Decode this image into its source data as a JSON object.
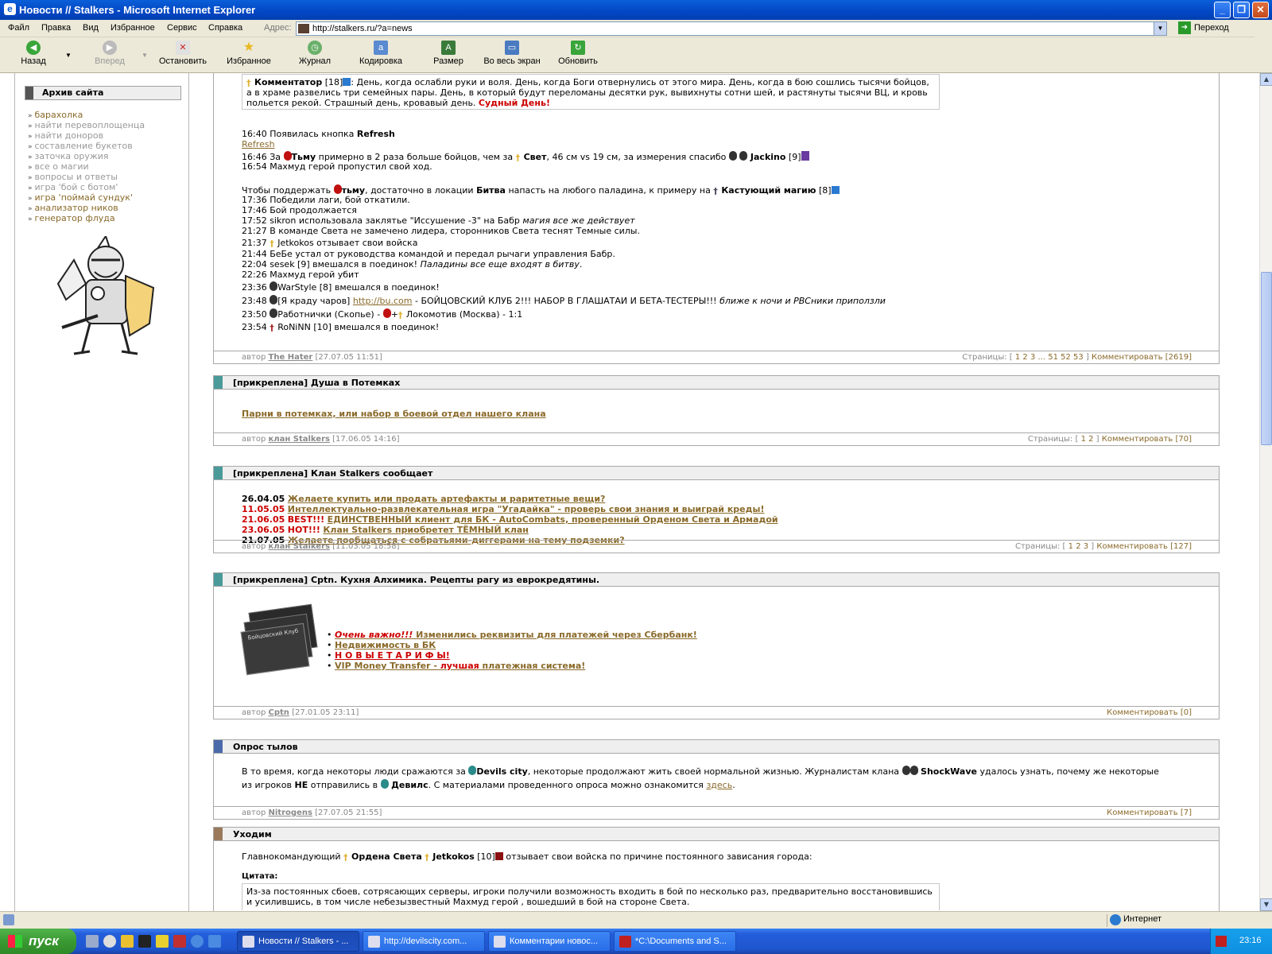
{
  "window": {
    "title": "Новости // Stalkers - Microsoft Internet Explorer"
  },
  "menu": [
    "Файл",
    "Правка",
    "Вид",
    "Избранное",
    "Сервис",
    "Справка"
  ],
  "address": {
    "label": "Адрес:",
    "url": "http://stalkers.ru/?a=news",
    "go": "Переход"
  },
  "toolbar": {
    "back": "Назад",
    "forward": "Вперед",
    "stop": "Остановить",
    "favorites": "Избранное",
    "history": "Журнал",
    "encoding": "Кодировка",
    "size": "Размер",
    "fullscreen": "Во весь экран",
    "refresh": "Обновить"
  },
  "sidebar": {
    "archive_title": "Архив сайта",
    "items": [
      {
        "label": "барахолка",
        "style": "brown"
      },
      {
        "label": "найти перевоплощенца",
        "style": "gray"
      },
      {
        "label": "найти доноров",
        "style": "gray"
      },
      {
        "label": "составление букетов",
        "style": "gray"
      },
      {
        "label": "заточка оружия",
        "style": "gray"
      },
      {
        "label": "все о магии",
        "style": "gray"
      },
      {
        "label": "вопросы и ответы",
        "style": "gray"
      },
      {
        "label": "игра 'бой с ботом'",
        "style": "gray"
      },
      {
        "label": "игра 'поймай сундук'",
        "style": "brown"
      },
      {
        "label": "анализатор ников",
        "style": "brown"
      },
      {
        "label": "генератор флуда",
        "style": "brown"
      }
    ]
  },
  "post1": {
    "quote_name": "Комментатор",
    "quote_level": "[18]",
    "quote_text_a": ": День, когда ослабли руки и воля. День, когда Боги отвернулись от этого мира. День, когда в бою сошлись тысячи бойцов,",
    "quote_text_b": "а в храме развелись три семейных пары. День, в который будут переломаны десятки рук, вывихнуты сотни шей, и растянуты тысячи ВЦ, и кровь",
    "quote_text_c": "польется рекой. Страшный день, кровавый день.",
    "quote_red": "Судный День!",
    "l1_time": "16:40 Появилась кнопка",
    "l1_bold": "Refresh",
    "l1_link": "Refresh",
    "l2_a": "16:46 За",
    "l2_b": "Тьму",
    "l2_c": "примерно в 2 раза больше бойцов, чем за",
    "l2_d": "Свет",
    "l2_e": ", 46 см vs 19 см, за измерения спасибо",
    "l2_f": "Jackino",
    "l2_g": "[9]",
    "l3": "16:54 Махмуд герой пропустил свой ход.",
    "l4_a": "Чтобы поддержать",
    "l4_b": "тьму",
    "l4_c": ", достаточно в локации",
    "l4_d": "Битва",
    "l4_e": "напасть на любого паладина, к примеру на",
    "l4_f": "Кастующий магию",
    "l4_g": "[8]",
    "l5": "17:36 Победили лаги, бой откатили.",
    "l6": "17:46 Бой продолжается",
    "l7_a": "17:52 sikron использовала заклятье \"Иссушение -3\" на Бабр",
    "l7_b": "магия все же действует",
    "l8": "21:27 В команде Света не замечено лидера, сторонников Света теснят Темные силы.",
    "l9_a": "21:37",
    "l9_b": "Jetkokos отзывает свои войска",
    "l10": "21:44 БеБе устал от руководства командой и передал рычаги управления Бабр.",
    "l11_a": "22:04 sesek [9] вмешался в поединок!",
    "l11_b": "Паладины все еще входят в битву",
    "l11_c": ".",
    "l12": "22:26 Махмуд герой убит",
    "l13_a": "23:36",
    "l13_b": "WarStyle [8] вмешался в поединок!",
    "l14_a": "23:48",
    "l14_b": "[Я краду чаров]",
    "l14_link": "http://bu.com",
    "l14_c": "- БОЙЦОВСКИЙ КЛУБ 2!!! НАБОР В ГЛАШАТАИ И БЕТА-ТЕСТЕРЫ!!!",
    "l14_d": "ближе к ночи и РВСники приползли",
    "l15_a": "23:50",
    "l15_b": "Работнички (Скопье) -",
    "l15_c": "+",
    "l15_d": "Локомотив (Москва) - 1:1",
    "l16_a": "23:54",
    "l16_b": "RoNiNN [10] вмешался в поединок!",
    "author_label": "автор",
    "author": "The Hater",
    "date": "[27.07.05 11:51]",
    "pages_label": "Страницы: [",
    "pages": "1 2 3 ... 51 52 53",
    "pages_end": "]",
    "comment": "Комментировать [2619]"
  },
  "post2": {
    "tag": "[прикреплена]",
    "title": "Душа в Потемках",
    "link": "Парни в потемках, или набор в боевой отдел нашего клана",
    "author_label": "автор",
    "author": "клан Stalkers",
    "date": "[17.06.05 14:16]",
    "pages_label": "Страницы: [",
    "pages": "1 2",
    "pages_end": "]",
    "comment": "Комментировать [70]"
  },
  "post3": {
    "tag": "[прикреплена]",
    "title": "Клан Stalkers сообщает",
    "items": [
      {
        "date": "26.04.05",
        "prefix": "",
        "text": "Желаете купить или продать артефакты и раритетные вещи?",
        "red": false
      },
      {
        "date": "11.05.05",
        "prefix": "",
        "text": "Интеллектуально-развлекательная игра \"Угадайка\" - проверь свои знания и выиграй креды!",
        "red": true
      },
      {
        "date": "21.06.05",
        "prefix": "BEST!!!",
        "text": "ЕДИНСТВЕННЫЙ клиент для БК - AutoCombats, проверенный Орденом Света и Армадой",
        "red": true
      },
      {
        "date": "23.06.05",
        "prefix": "HOT!!!",
        "text": "Клан Stalkers приобретет ТЁМНЫЙ клан",
        "red": true
      },
      {
        "date": "21.07.05",
        "prefix": "",
        "text": "Желаете пообщаться с собратьями-диггерами на тему подземки?",
        "red": false
      }
    ],
    "author_label": "автор",
    "author": "клан Stalkers",
    "date": "[11.03.05 18:58]",
    "pages_label": "Страницы: [",
    "pages": "1 2 3",
    "pages_end": "]",
    "comment": "Комментировать [127]"
  },
  "post4": {
    "tag": "[прикреплена]",
    "title": "Cptn. Кухня Алхимика. Рецепты рагу из еврокредятины.",
    "card_text": "Бойцовский Клуб",
    "b1_red": "Очень важно!!!",
    "b1_link": "Изменились реквизиты для платежей через Сбербанк!",
    "b2": "Недвижимость в БК",
    "b3": "Н О В Ы Е Т А Р И Ф Ы!",
    "b4_a": "VIP Money Transfer -",
    "b4_b": "лучшая",
    "b4_c": "платежная система!",
    "author_label": "автор",
    "author": "Cptn",
    "date": "[27.01.05 23:11]",
    "comment": "Комментировать [0]"
  },
  "post5": {
    "title": "Опрос тылов",
    "p1_a": "В то время, когда некоторы люди сражаются за",
    "p1_b": "Devils city",
    "p1_c": ", некоторые продолжают жить своей нормальной жизнью. Журналистам клана",
    "p1_d": "ShockWave",
    "p1_e": "удалось узнать, почему же некоторые",
    "p2_a": "из игроков",
    "p2_b": "НЕ",
    "p2_c": "отправились в",
    "p2_d": "Девилс",
    "p2_e": ". С материалами проведенного опроса можно ознакомится",
    "p2_link": "здесь",
    "p2_f": ".",
    "author_label": "автор",
    "author": "Nitrogens",
    "date": "[27.07.05 21:55]",
    "comment": "Комментировать [7]"
  },
  "post6": {
    "title": "Уходим",
    "l1_a": "Главнокомандующий",
    "l1_b": "Ордена Света",
    "l1_c": "Jetkokos",
    "l1_d": "[10]",
    "l1_e": "отзывает свои войска по причине постоянного зависания города:",
    "quote_label": "Цитата:",
    "quote_a": "Из-за постоянных сбоев, сотрясающих серверы, игроки получили возможность входить в бой по несколько раз, предварительно восстановившись",
    "quote_b": "и усилившись, в том числе небезызвестный Махмуд герой , вошедший в бой на стороне Света."
  },
  "status": {
    "zone": "Интернет"
  },
  "taskbar": {
    "start": "пуск",
    "tasks": [
      "Новости // Stalkers - ...",
      "http://devilscity.com...",
      "Комментарии новос...",
      "*C:\\Documents and S..."
    ],
    "clock": "23:16"
  },
  "colors": {
    "accent_teal": "#4a9a9a",
    "accent_blue": "#4a6aaa",
    "accent_brown": "#9a7a5a",
    "link": "#8a6a2a",
    "red": "#cc0000"
  }
}
